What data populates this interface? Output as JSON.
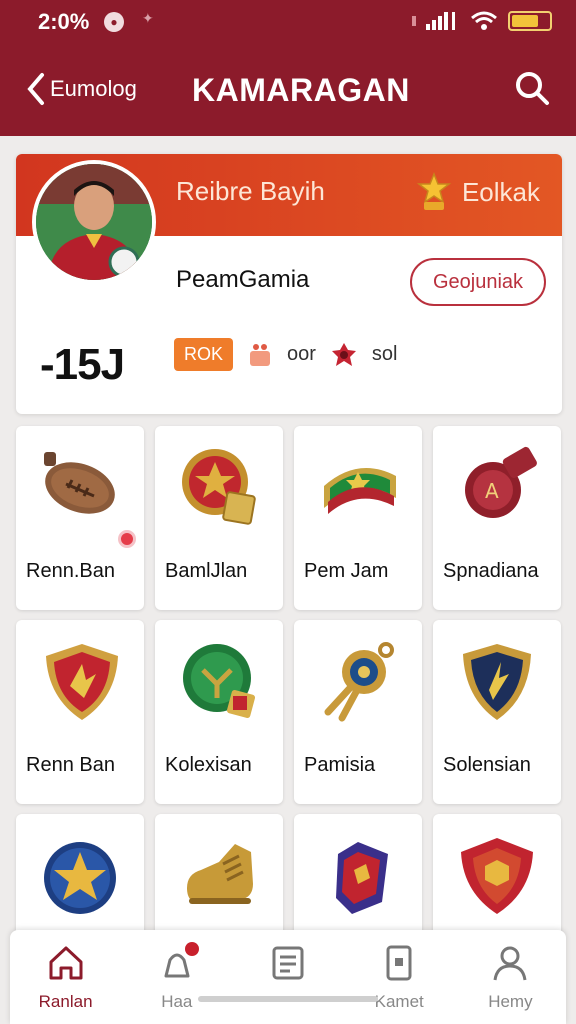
{
  "status": {
    "time": "2:0%"
  },
  "header": {
    "back_label": "Eumolog",
    "title": "KAMARAGAN"
  },
  "profile": {
    "banner_text": "Reibre Bayih",
    "badge_label": "Eolkak",
    "username": "PeamGamia",
    "follow_label": "Geojuniak",
    "score": "-15J",
    "tag": "ROK",
    "stat2": "oor",
    "stat3": "sol"
  },
  "items": [
    {
      "label": "Renn.Ban"
    },
    {
      "label": "BamlJlan"
    },
    {
      "label": "Pem Jam"
    },
    {
      "label": "Spnadiana"
    },
    {
      "label": "Renn Ban"
    },
    {
      "label": "Kolexisan"
    },
    {
      "label": "Pamisia"
    },
    {
      "label": "Solensian"
    },
    {
      "label": ""
    },
    {
      "label": ""
    },
    {
      "label": ""
    },
    {
      "label": ""
    }
  ],
  "nav": [
    {
      "label": "Ranlan",
      "icon": "home-icon"
    },
    {
      "label": "Haa",
      "icon": "bell-icon"
    },
    {
      "label": "",
      "icon": "list-icon"
    },
    {
      "label": "Kamet",
      "icon": "card-icon"
    },
    {
      "label": "Hemy",
      "icon": "profile-icon"
    }
  ],
  "colors": {
    "brand": "#8c1b2b",
    "accent": "#e04a22"
  }
}
